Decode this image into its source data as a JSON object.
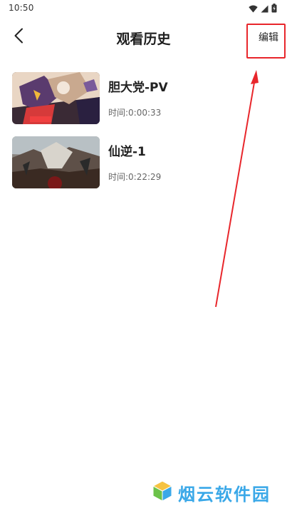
{
  "status_bar": {
    "time": "10:50",
    "icons": [
      "wifi-icon",
      "signal-icon",
      "battery-charging-icon"
    ]
  },
  "header": {
    "back_icon": "chevron-left-icon",
    "title": "观看历史",
    "edit_label": "编辑"
  },
  "history": [
    {
      "title": "胆大党-PV",
      "time": "时间:0:00:33",
      "thumbnail": "anime-poster-thumbnail"
    },
    {
      "title": "仙逆-1",
      "time": "时间:0:22:29",
      "thumbnail": "fantasy-landscape-thumbnail"
    }
  ],
  "annotation": {
    "color": "#e8262b",
    "shape": "highlight-box-with-arrow"
  },
  "watermark": {
    "text": "烟云软件园",
    "color": "#3aa8e8"
  }
}
